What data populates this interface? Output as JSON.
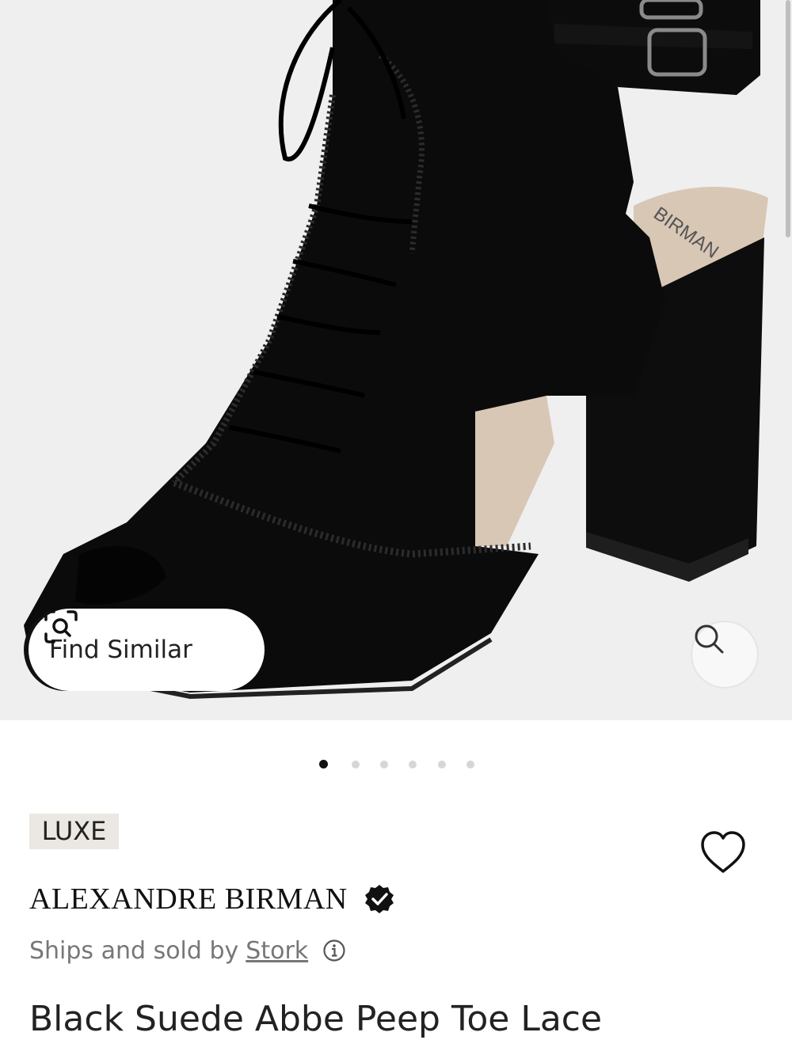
{
  "product_image": {
    "alt": "Black suede lace-up peep toe block heel sandal",
    "insole_brand_text": "BIRMAN",
    "colors": {
      "background": "#efefef",
      "suede": "#0b0b0b",
      "insole": "#d9c7b5"
    }
  },
  "find_similar": {
    "label": "Find Similar",
    "icon": "camera-search-icon"
  },
  "zoom": {
    "icon": "magnifier-icon"
  },
  "carousel": {
    "total": 6,
    "active_index": 0
  },
  "product": {
    "badge": "LUXE",
    "brand": "ALEXANDRE BIRMAN",
    "seller_prefix": "Ships and sold by",
    "seller_name": "Stork",
    "title": "Black Suede Abbe Peep Toe Lace"
  },
  "icons": {
    "wishlist": "heart-outline-icon",
    "verified": "verified-badge-icon",
    "info": "info-circle-icon"
  }
}
